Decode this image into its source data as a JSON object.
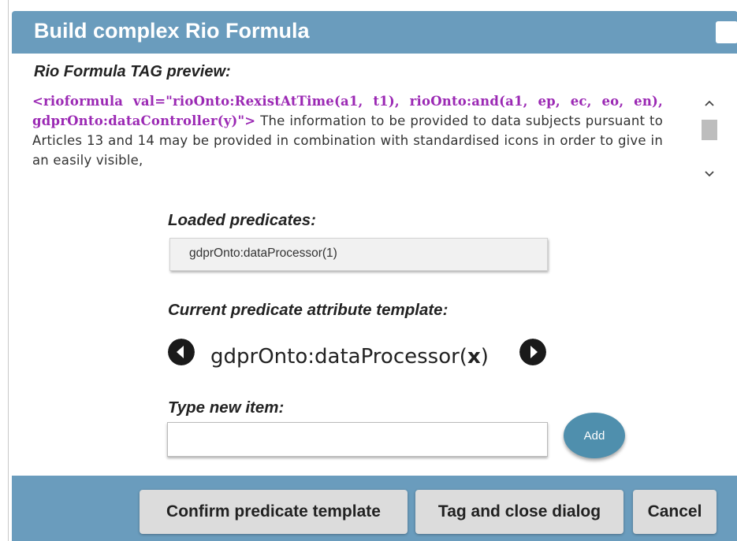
{
  "dialog": {
    "title": "Build complex Rio Formula"
  },
  "preview": {
    "heading": "Rio Formula TAG preview:",
    "tag_text": "<rioformula val=\"rioOnto:RexistAtTime(a1, t1), rioOnto:and(a1, ep, ec, eo, en), gdprOnto:dataController(y)\">",
    "body_text": " The information to be provided to data subjects pursuant to Articles 13 and 14 may be provided in combination with standardised icons in order to give in an easily visible,"
  },
  "loaded_predicates": {
    "label": "Loaded predicates:",
    "items": [
      "gdprOnto:dataProcessor(1)"
    ]
  },
  "current_template": {
    "label": "Current predicate attribute template:",
    "prefix": "gdprOnto:dataProcessor(",
    "variable": "x",
    "suffix": ")"
  },
  "new_item": {
    "label": "Type new item:",
    "value": "",
    "add_label": "Add"
  },
  "footer": {
    "confirm_label": "Confirm predicate template",
    "tag_close_label": "Tag and close dialog",
    "cancel_label": "Cancel"
  },
  "icons": {
    "prev": "chevron-left-circle-icon",
    "next": "chevron-right-circle-icon",
    "scroll_up": "scroll-up-arrow-icon",
    "scroll_down": "scroll-down-arrow-icon"
  },
  "colors": {
    "titlebar": "#6a9cbd",
    "tag": "#9b29b4",
    "add_button": "#4f8fad"
  }
}
